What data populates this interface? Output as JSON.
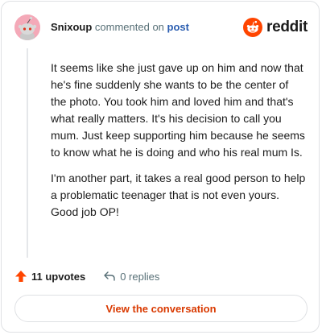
{
  "header": {
    "username": "Snixoup",
    "action": "commented on",
    "target": "post"
  },
  "brand": {
    "name": "reddit",
    "icon": "reddit-logo-icon",
    "color": "#ff4500"
  },
  "comment": {
    "paragraphs": [
      "It seems like she just gave up on him and now that he's fine suddenly she wants to be the center of the photo. You took him and loved him and that's what really matters. It's his decision to call you mum. Just keep supporting him because he seems to know what he is doing and who his real mum Is.",
      "I'm another part, it takes a real good person to help a problematic teenager that is not even yours. Good job OP!"
    ]
  },
  "footer": {
    "upvotes": "11 upvotes",
    "replies": "0 replies",
    "upvote_icon": "upvote-arrow-icon",
    "reply_icon": "reply-arrow-icon",
    "upvote_color": "#ff4500"
  },
  "cta": {
    "label": "View the conversation",
    "color": "#d93900"
  }
}
